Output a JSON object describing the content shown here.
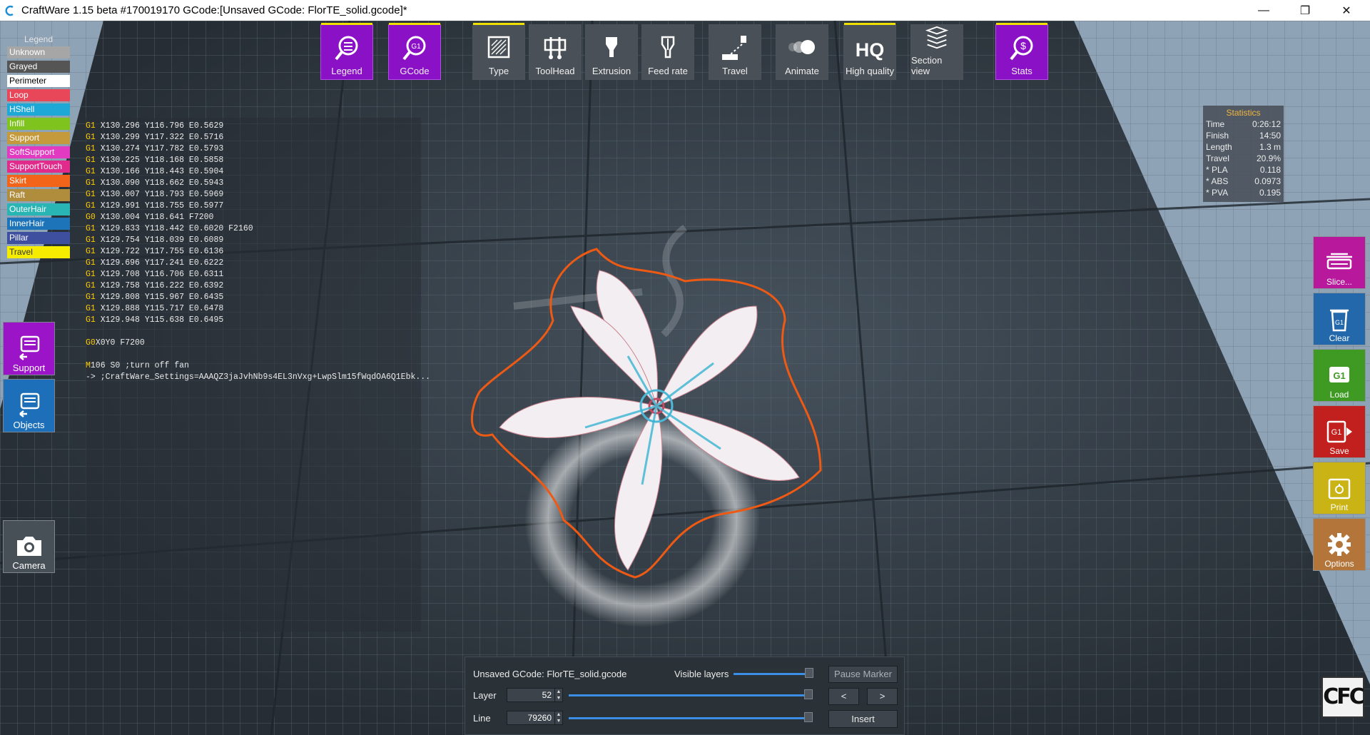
{
  "titlebar": {
    "title": "CraftWare 1.15 beta #170019170   GCode:[Unsaved GCode: FlorTE_solid.gcode]*",
    "minimize_icon": "minimize-icon",
    "maximize_icon": "restore-icon",
    "close_icon": "close-icon"
  },
  "legend": {
    "title": "Legend",
    "items": [
      {
        "label": "Unknown",
        "color": "#a6a6a6",
        "text_color": "#ffffff"
      },
      {
        "label": "Grayed",
        "color": "#555555",
        "text_color": "#ffffff"
      },
      {
        "label": "Perimeter",
        "color": "#ffffff",
        "text_color": "#000000"
      },
      {
        "label": "Loop",
        "color": "#e8475a",
        "text_color": "#ffffff"
      },
      {
        "label": "HShell",
        "color": "#1ea8d6",
        "text_color": "#ffffff"
      },
      {
        "label": "Infill",
        "color": "#7fc31e",
        "text_color": "#ffffff"
      },
      {
        "label": "Support",
        "color": "#c49a3c",
        "text_color": "#ffffff"
      },
      {
        "label": "SoftSupport",
        "color": "#e23ac1",
        "text_color": "#ffffff"
      },
      {
        "label": "SupportTouch",
        "color": "#e02b8c",
        "text_color": "#ffffff"
      },
      {
        "label": "Skirt",
        "color": "#f26419",
        "text_color": "#ffffff"
      },
      {
        "label": "Raft",
        "color": "#b08d3c",
        "text_color": "#ffffff"
      },
      {
        "label": "OuterHair",
        "color": "#2ab5b5",
        "text_color": "#ffffff"
      },
      {
        "label": "InnerHair",
        "color": "#1e74b8",
        "text_color": "#ffffff"
      },
      {
        "label": "Pillar",
        "color": "#3f4fa0",
        "text_color": "#ffffff"
      },
      {
        "label": "Travel",
        "color": "#f5ec00",
        "text_color": "#333333"
      }
    ]
  },
  "toolbar": {
    "legend": {
      "label": "Legend",
      "icon": "legend-magnifier-icon"
    },
    "gcode": {
      "label": "GCode",
      "icon": "gcode-magnifier-icon"
    },
    "type": {
      "label": "Type",
      "icon": "type-icon"
    },
    "toolhead": {
      "label": "ToolHead",
      "icon": "toolhead-icon"
    },
    "extrusion": {
      "label": "Extrusion",
      "icon": "extrusion-icon"
    },
    "feedrate": {
      "label": "Feed rate",
      "icon": "feedrate-icon"
    },
    "travel": {
      "label": "Travel",
      "icon": "travel-icon"
    },
    "animate": {
      "label": "Animate",
      "icon": "animate-icon"
    },
    "hq": {
      "label": "High quality",
      "badge": "HQ",
      "icon": "hq-icon"
    },
    "section": {
      "label": "Section view",
      "icon": "section-view-icon"
    },
    "stats": {
      "label": "Stats",
      "icon": "stats-magnifier-icon"
    }
  },
  "gcode_lines": [
    {
      "cmd": "G1",
      "rest": " X130.296 Y116.796 E0.5629"
    },
    {
      "cmd": "G1",
      "rest": " X130.299 Y117.322 E0.5716"
    },
    {
      "cmd": "G1",
      "rest": " X130.274 Y117.782 E0.5793"
    },
    {
      "cmd": "G1",
      "rest": " X130.225 Y118.168 E0.5858"
    },
    {
      "cmd": "G1",
      "rest": " X130.166 Y118.443 E0.5904"
    },
    {
      "cmd": "G1",
      "rest": " X130.090 Y118.662 E0.5943"
    },
    {
      "cmd": "G1",
      "rest": " X130.007 Y118.793 E0.5969"
    },
    {
      "cmd": "G1",
      "rest": " X129.991 Y118.755 E0.5977"
    },
    {
      "cmd": "G0",
      "rest": " X130.004 Y118.641 F7200"
    },
    {
      "cmd": "G1",
      "rest": " X129.833 Y118.442 E0.6020 F2160"
    },
    {
      "cmd": "G1",
      "rest": " X129.754 Y118.039 E0.6089"
    },
    {
      "cmd": "G1",
      "rest": " X129.722 Y117.755 E0.6136"
    },
    {
      "cmd": "G1",
      "rest": " X129.696 Y117.241 E0.6222"
    },
    {
      "cmd": "G1",
      "rest": " X129.708 Y116.706 E0.6311"
    },
    {
      "cmd": "G1",
      "rest": " X129.758 Y116.222 E0.6392"
    },
    {
      "cmd": "G1",
      "rest": " X129.808 Y115.967 E0.6435"
    },
    {
      "cmd": "G1",
      "rest": " X129.888 Y115.717 E0.6478"
    },
    {
      "cmd": "G1",
      "rest": " X129.948 Y115.638 E0.6495"
    },
    {
      "cmd": "",
      "rest": ""
    },
    {
      "cmd": "G0",
      "rest": "X0Y0 F7200"
    },
    {
      "cmd": "",
      "rest": ""
    },
    {
      "cmd": "M",
      "rest": "106 S0 ;turn off fan"
    },
    {
      "cmd": "",
      "rest": "-> ;CraftWare_Settings=AAAQZ3jaJvhNb9s4EL3nVxg+LwpSlm15fWqdOA6Q1Ebk..."
    }
  ],
  "left_buttons": {
    "support": {
      "label": "Support",
      "icon": "support-printer-icon"
    },
    "objects": {
      "label": "Objects",
      "icon": "objects-printer-icon"
    },
    "camera": {
      "label": "Camera",
      "icon": "camera-icon"
    }
  },
  "stats": {
    "title": "Statistics",
    "rows": [
      {
        "label": "Time",
        "value": "0:26:12"
      },
      {
        "label": "Finish",
        "value": "14:50"
      },
      {
        "label": "Length",
        "value": "1.3 m"
      },
      {
        "label": "Travel",
        "value": "20.9%"
      },
      {
        "label": " * PLA",
        "value": "0.118"
      },
      {
        "label": " * ABS",
        "value": "0.0973"
      },
      {
        "label": " * PVA",
        "value": "0.195"
      }
    ]
  },
  "right_buttons": {
    "slice": {
      "label": "Slice...",
      "icon": "slice-icon",
      "color": "#b8189c"
    },
    "clear": {
      "label": "Clear",
      "icon": "trash-icon",
      "color": "#2468ac"
    },
    "load": {
      "label": "Load",
      "icon": "load-gcode-icon",
      "color": "#3e9a22"
    },
    "save": {
      "label": "Save",
      "icon": "save-gcode-icon",
      "color": "#c2201e"
    },
    "print": {
      "label": "Print",
      "icon": "print-icon",
      "color": "#c9b315"
    },
    "options": {
      "label": "Options",
      "icon": "gear-icon",
      "color": "#b4753a"
    }
  },
  "bottom": {
    "file_name": "Unsaved GCode: FlorTE_solid.gcode",
    "visible_layers_label": "Visible layers",
    "pause_marker": "Pause Marker",
    "layer_label": "Layer",
    "layer_value": "52",
    "line_label": "Line",
    "line_value": "79260",
    "prev": "<",
    "next": ">",
    "insert": "Insert",
    "visible_layers_fraction": 1.0,
    "layer_fraction": 1.0,
    "line_fraction": 1.0
  },
  "logo": {
    "text": "CFC"
  }
}
